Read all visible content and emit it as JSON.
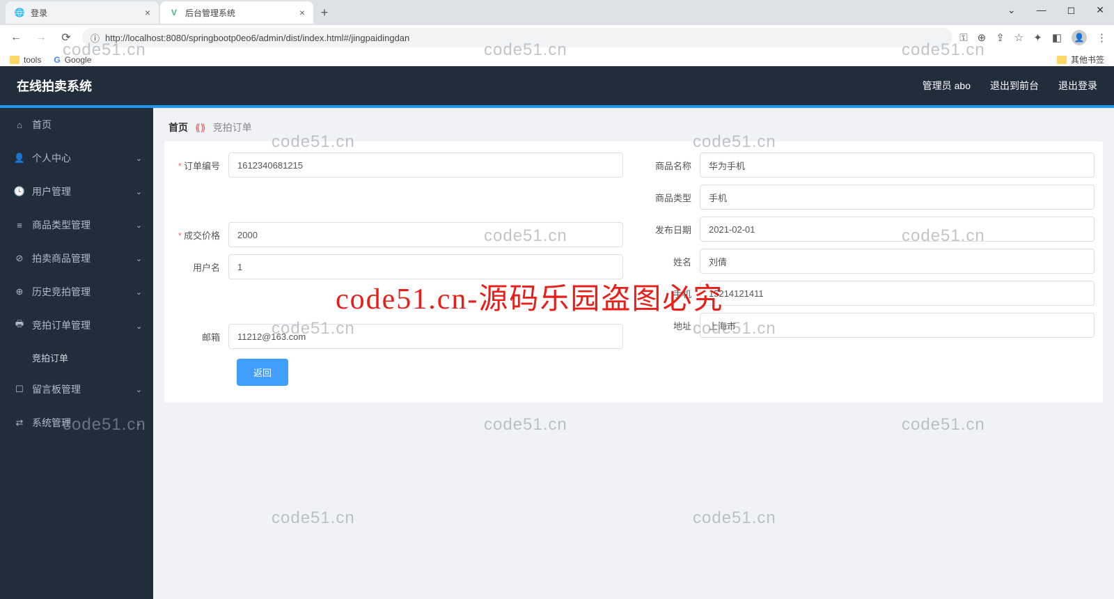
{
  "browser": {
    "tabs": [
      {
        "title": "登录",
        "favicon": "🌐"
      },
      {
        "title": "后台管理系统",
        "favicon": "V"
      }
    ],
    "url": "http://localhost:8080/springbootp0eo6/admin/dist/index.html#/jingpaidingdan",
    "bookmarks": {
      "tools": "tools",
      "google": "Google",
      "other": "其他书签"
    }
  },
  "header": {
    "title": "在线拍卖系统",
    "user": "管理员 abo",
    "exit_front": "退出到前台",
    "logout": "退出登录"
  },
  "sidebar": [
    {
      "icon": "⌂",
      "label": "首页",
      "expand": false
    },
    {
      "icon": "👤",
      "label": "个人中心",
      "expand": true
    },
    {
      "icon": "🕓",
      "label": "用户管理",
      "expand": true
    },
    {
      "icon": "≡",
      "label": "商品类型管理",
      "expand": true
    },
    {
      "icon": "⊘",
      "label": "拍卖商品管理",
      "expand": true
    },
    {
      "icon": "⊕",
      "label": "历史竞拍管理",
      "expand": true
    },
    {
      "icon": "🖶",
      "label": "竞拍订单管理",
      "expand": true,
      "open": true,
      "children": [
        {
          "label": "竞拍订单"
        }
      ]
    },
    {
      "icon": "☐",
      "label": "留言板管理",
      "expand": true
    },
    {
      "icon": "⇄",
      "label": "系统管理",
      "expand": true
    }
  ],
  "breadcrumb": {
    "home": "首页",
    "current": "竞拍订单"
  },
  "form": {
    "order_no": {
      "label": "订单编号",
      "value": "1612340681215",
      "required": true
    },
    "product": {
      "label": "商品名称",
      "value": "华为手机"
    },
    "type": {
      "label": "商品类型",
      "value": "手机"
    },
    "deal_price": {
      "label": "成交价格",
      "value": "2000",
      "required": true
    },
    "publish": {
      "label": "发布日期",
      "value": "2021-02-01"
    },
    "username": {
      "label": "用户名",
      "value": "1"
    },
    "realname": {
      "label": "姓名",
      "value": "刘倩"
    },
    "phone": {
      "label": "手机",
      "value": "15214121411"
    },
    "email": {
      "label": "邮箱",
      "value": "11212@163.com"
    },
    "address": {
      "label": "地址",
      "value": "上海市"
    },
    "back_btn": "返回"
  },
  "watermark": {
    "text": "code51.cn",
    "red": "code51.cn-源码乐园盗图必究"
  }
}
